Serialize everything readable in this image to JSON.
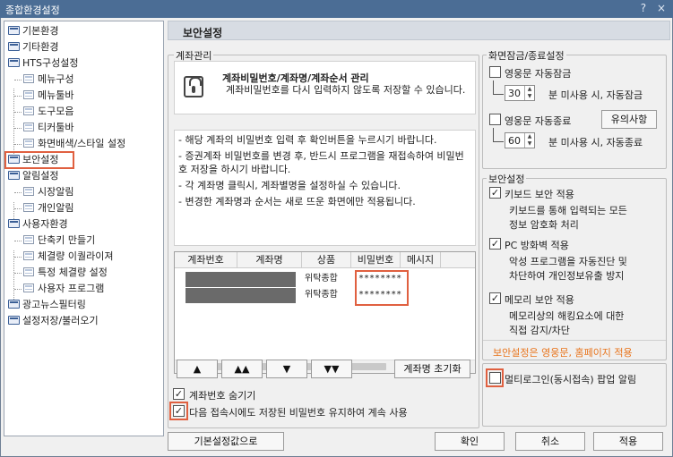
{
  "window": {
    "title": "종합환경설정",
    "help_icon": "?",
    "close_icon": "×"
  },
  "tree": {
    "items": [
      {
        "label": "기본환경",
        "kind": "folder"
      },
      {
        "label": "기타환경",
        "kind": "folder"
      },
      {
        "label": "HTS구성설정",
        "kind": "folder"
      },
      {
        "label": "메뉴구성",
        "kind": "page"
      },
      {
        "label": "메뉴툴바",
        "kind": "page"
      },
      {
        "label": "도구모음",
        "kind": "page"
      },
      {
        "label": "티커툴바",
        "kind": "page"
      },
      {
        "label": "화면배색/스타일 설정",
        "kind": "page"
      },
      {
        "label": "보안설정",
        "kind": "folder",
        "selected": true
      },
      {
        "label": "알림설정",
        "kind": "folder"
      },
      {
        "label": "시장알림",
        "kind": "page"
      },
      {
        "label": "개인알림",
        "kind": "page"
      },
      {
        "label": "사용자환경",
        "kind": "folder"
      },
      {
        "label": "단축키 만들기",
        "kind": "page"
      },
      {
        "label": "체결량 이퀄라이져",
        "kind": "page"
      },
      {
        "label": "특정 체결량 설정",
        "kind": "page"
      },
      {
        "label": "사용자 프로그램",
        "kind": "page"
      },
      {
        "label": "광고뉴스필터링",
        "kind": "folder"
      },
      {
        "label": "설정저장/불러오기",
        "kind": "folder"
      }
    ]
  },
  "header": {
    "title": "보안설정"
  },
  "account": {
    "group_label": "계좌관리",
    "info_title": "계좌비밀번호/계좌명/계좌순서 관리",
    "info_text": "계좌비밀번호를 다시 입력하지 않도록 저장할 수 있습니다.",
    "notes": [
      "- 해당 계좌의 비밀번호 입력 후 확인버튼을 누르시기 바랍니다.",
      "- 증권계좌 비밀번호를 변경 후, 반드시 프로그램을 재접속하여 비밀번호 저장을 하시기 바랍니다.",
      "- 각 계좌명 클릭시, 계좌별명을 설정하실 수 있습니다.",
      "- 변경한 계좌명과 순서는 새로 뜨운 화면에만 적용됩니다."
    ],
    "table": {
      "columns": [
        "계좌번호",
        "계좌명",
        "상품",
        "비밀번호",
        "메시지"
      ],
      "rows": [
        {
          "product": "위탁종합",
          "password": "********"
        },
        {
          "product": "위탁종합",
          "password": "********"
        }
      ]
    },
    "order_buttons": [
      "▲",
      "▲▲",
      "▼",
      "▼▼"
    ],
    "reset_names_label": "계좌명 초기화",
    "hide_account_label": "계좌번호 숨기기",
    "keep_password_label": "다음 접속시에도 저장된 비밀번호 유지하여 계속 사용",
    "hide_account_checked": true,
    "keep_password_checked": true
  },
  "screen_lock": {
    "group_label": "화면잠금/종료설정",
    "auto_lock_label": "영웅문 자동잠금",
    "auto_lock_minutes": "30",
    "auto_lock_suffix": "분 미사용 시, 자동잠금",
    "auto_exit_label": "영웅문 자동종료",
    "notice_button": "유의사항",
    "auto_exit_minutes": "60",
    "auto_exit_suffix": "분 미사용 시, 자동종료"
  },
  "security": {
    "group_label": "보안설정",
    "options": [
      {
        "label": "키보드 보안 적용",
        "desc1": "키보드를 통해 입력되는 모든",
        "desc2": "정보 암호화 처리"
      },
      {
        "label": "PC 방화벽 적용",
        "desc1": "악성 프로그램을 자동진단 및",
        "desc2": "차단하여 개인정보유출 방지"
      },
      {
        "label": "메모리 보안 적용",
        "desc1": "메모리상의 해킹요소에 대한",
        "desc2": "직접 감지/차단"
      }
    ],
    "note": "보안설정은 영웅문, 홈페이지 적용",
    "note_color": "#e8741c",
    "multi_login_label": "멀티로그인(동시접속) 팝업 알림"
  },
  "footer": {
    "defaults_label": "기본설정값으로",
    "ok_label": "확인",
    "cancel_label": "취소",
    "apply_label": "적용"
  },
  "colors": {
    "title_bar": "#4b6d95",
    "highlight": "#e06040",
    "header": "#d7dce3"
  }
}
